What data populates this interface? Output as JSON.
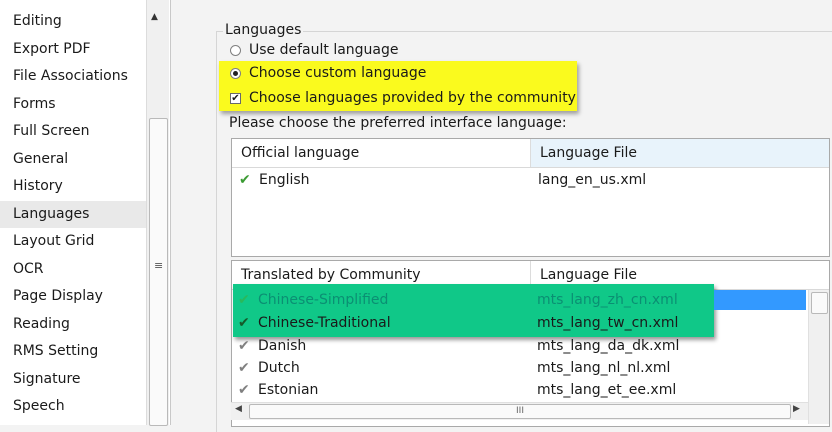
{
  "sidebar": {
    "items": [
      {
        "label": "Editing"
      },
      {
        "label": "Export PDF"
      },
      {
        "label": "File Associations"
      },
      {
        "label": "Forms"
      },
      {
        "label": "Full Screen"
      },
      {
        "label": "General"
      },
      {
        "label": "History"
      },
      {
        "label": "Languages",
        "selected": true
      },
      {
        "label": "Layout Grid"
      },
      {
        "label": "OCR"
      },
      {
        "label": "Page Display"
      },
      {
        "label": "Reading"
      },
      {
        "label": "RMS Setting"
      },
      {
        "label": "Signature"
      },
      {
        "label": "Speech"
      }
    ],
    "scroll_up_glyph": "▲",
    "grip_glyph": "≡"
  },
  "languages": {
    "group_title": "Languages",
    "opt_default": "Use default language",
    "opt_custom": "Choose custom language",
    "opt_community": "Choose languages provided by the community",
    "prompt": "Please choose the preferred interface language:",
    "official": {
      "col1": "Official language",
      "col2": "Language File",
      "rows": [
        {
          "name": "English",
          "file": "lang_en_us.xml"
        }
      ]
    },
    "community": {
      "col1": "Translated by Community",
      "col2": "Language File",
      "rows": [
        {
          "name": "Chinese-Simplified",
          "file": "mts_lang_zh_cn.xml"
        },
        {
          "name": "Chinese-Traditional",
          "file": "mts_lang_tw_cn.xml"
        },
        {
          "name": "Danish",
          "file": "mts_lang_da_dk.xml"
        },
        {
          "name": "Dutch",
          "file": "mts_lang_nl_nl.xml"
        },
        {
          "name": "Estonian",
          "file": "mts_lang_et_ee.xml"
        }
      ]
    },
    "check_glyph": "✔",
    "hscroll_grip": "III"
  },
  "colors": {
    "highlight_yellow": "#fafa1e",
    "highlight_green": "#10c888",
    "selection_blue": "#3399ff"
  }
}
